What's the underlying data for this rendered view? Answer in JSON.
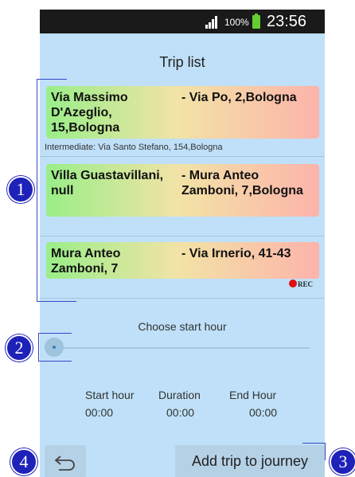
{
  "status_bar": {
    "battery_percent": "100%",
    "time": "23:56"
  },
  "header": {
    "title": "Trip list"
  },
  "trips": [
    {
      "from": "Via Massimo D'Azeglio, 15,Bologna",
      "to": "- Via Po, 2,Bologna",
      "intermediate": "Intermediate: Via Santo Stefano, 154,Bologna"
    },
    {
      "from": "Villa Guastavillani, null",
      "to": "- Mura Anteo Zamboni, 7,Bologna"
    },
    {
      "from": "Mura Anteo Zamboni, 7",
      "to": "- Via Irnerio, 41-43"
    }
  ],
  "rec_label": "REC",
  "start_hour_picker": {
    "label": "Choose start hour",
    "value": 0
  },
  "summary": {
    "start_label": "Start hour",
    "start_value": "00:00",
    "duration_label": "Duration",
    "duration_value": "00:00",
    "end_label": "End Hour",
    "end_value": "00:00"
  },
  "buttons": {
    "back_icon": "undo-arrow-icon",
    "add_trip": "Add trip to journey"
  },
  "callouts": [
    "1",
    "2",
    "3",
    "4"
  ],
  "colors": {
    "background": "#bfe0f8",
    "callout": "#1e22b8",
    "rec": "#e01010"
  }
}
